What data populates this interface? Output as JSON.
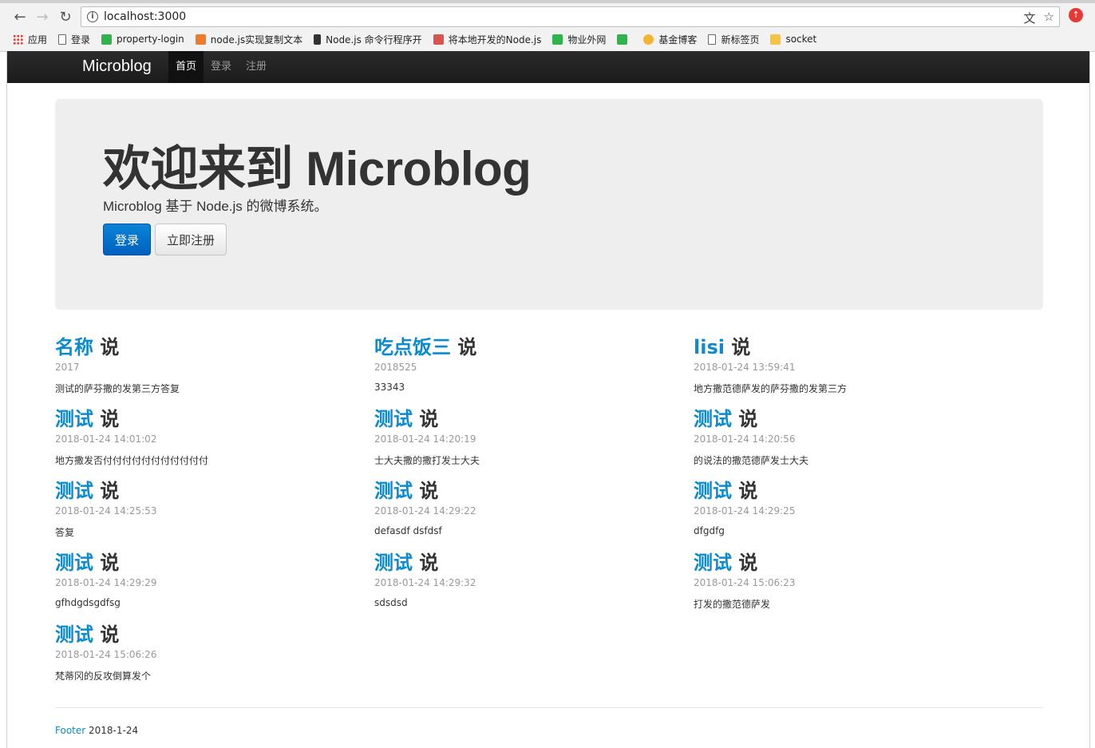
{
  "browser": {
    "url": "localhost:3000",
    "bookmarks": [
      {
        "label": "应用",
        "icon": "apps-grid-icon"
      },
      {
        "label": "登录",
        "icon": "page-icon"
      },
      {
        "label": "property-login",
        "icon": "green-icon"
      },
      {
        "label": "node.js实现复制文本",
        "icon": "orange-icon"
      },
      {
        "label": "Node.js 命令行程序开",
        "icon": "ink-icon"
      },
      {
        "label": "将本地开发的Node.js",
        "icon": "chinese-icon"
      },
      {
        "label": "物业外网",
        "icon": "green-icon"
      },
      {
        "label": "",
        "icon": "green-icon"
      },
      {
        "label": "基金博客",
        "icon": "hand-icon"
      },
      {
        "label": "新标签页",
        "icon": "page-icon"
      },
      {
        "label": "socket",
        "icon": "folder-icon"
      }
    ]
  },
  "navbar": {
    "brand": "Microblog",
    "links": [
      "首页",
      "登录",
      "注册"
    ]
  },
  "hero": {
    "title": "欢迎来到 Microblog",
    "subtitle": "Microblog 基于 Node.js 的微博系统。",
    "login_label": "登录",
    "register_label": "立即注册"
  },
  "posts": [
    {
      "user": "名称",
      "says": "说",
      "time": "2017",
      "body": "测试的萨芬撒的发第三方答复"
    },
    {
      "user": "吃点饭三",
      "says": "说",
      "time": "2018525",
      "body": "33343"
    },
    {
      "user": "lisi",
      "says": "说",
      "time": "2018-01-24 13:59:41",
      "body": "地方撒范德萨发的萨芬撒的发第三方"
    },
    {
      "user": "测试",
      "says": "说",
      "time": "2018-01-24 14:01:02",
      "body": "地方撒发否付付付付付付付付付付付"
    },
    {
      "user": "测试",
      "says": "说",
      "time": "2018-01-24 14:20:19",
      "body": "士大夫撒的撒打发士大夫"
    },
    {
      "user": "测试",
      "says": "说",
      "time": "2018-01-24 14:20:56",
      "body": "的说法的撒范德萨发士大夫"
    },
    {
      "user": "测试",
      "says": "说",
      "time": "2018-01-24 14:25:53",
      "body": "答复"
    },
    {
      "user": "测试",
      "says": "说",
      "time": "2018-01-24 14:29:22",
      "body": "defasdf dsfdsf"
    },
    {
      "user": "测试",
      "says": "说",
      "time": "2018-01-24 14:29:25",
      "body": "dfgdfg"
    },
    {
      "user": "测试",
      "says": "说",
      "time": "2018-01-24 14:29:29",
      "body": "gfhdgdsgdfsg"
    },
    {
      "user": "测试",
      "says": "说",
      "time": "2018-01-24 14:29:32",
      "body": "sdsdsd"
    },
    {
      "user": "测试",
      "says": "说",
      "time": "2018-01-24 15:06:23",
      "body": "打发的撒范德萨发"
    },
    {
      "user": "测试",
      "says": "说",
      "time": "2018-01-24 15:06:26",
      "body": "梵蒂冈的反攻倒算发个"
    }
  ],
  "footer": {
    "link": "Footer",
    "date": "2018-1-24"
  },
  "colors": {
    "accent": "#0a8bd1",
    "navbar": "#222222",
    "hero_bg": "#eeeeee",
    "primary_button": "#0074cc"
  }
}
